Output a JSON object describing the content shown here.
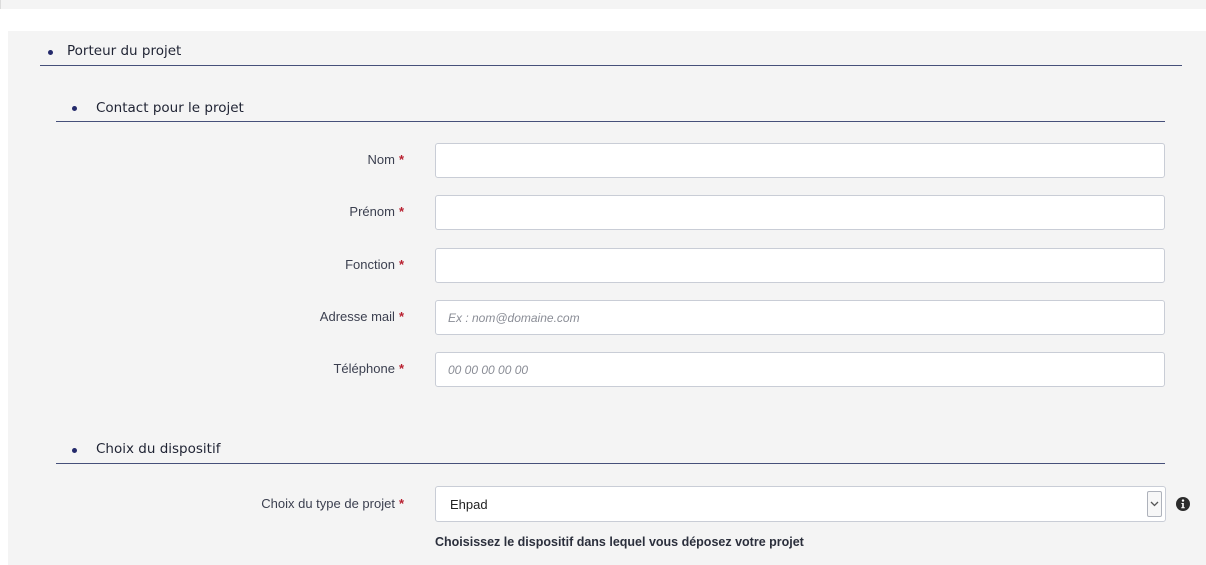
{
  "sections": {
    "porteur": "Porteur du projet",
    "contact": "Contact pour le projet",
    "dispositif": "Choix du dispositif"
  },
  "required_marker": "*",
  "fields": {
    "nom": {
      "label": "Nom",
      "value": "",
      "placeholder": ""
    },
    "prenom": {
      "label": "Prénom",
      "value": "",
      "placeholder": ""
    },
    "fonction": {
      "label": "Fonction",
      "value": "",
      "placeholder": ""
    },
    "email": {
      "label": "Adresse mail",
      "value": "",
      "placeholder": "Ex : nom@domaine.com"
    },
    "telephone": {
      "label": "Téléphone",
      "value": "",
      "placeholder": "00 00 00 00 00"
    }
  },
  "project_type": {
    "label": "Choix du type de projet",
    "selected": "Ehpad",
    "help": "Choisissez le dispositif dans lequel vous déposez votre projet"
  },
  "icons": {
    "info": "info-icon",
    "select_arrow": "chevron-down-icon"
  },
  "colors": {
    "bullet": "#242a6b",
    "required": "#b81f2f",
    "section_rule": "#46507a",
    "panel": "#f4f4f4"
  }
}
